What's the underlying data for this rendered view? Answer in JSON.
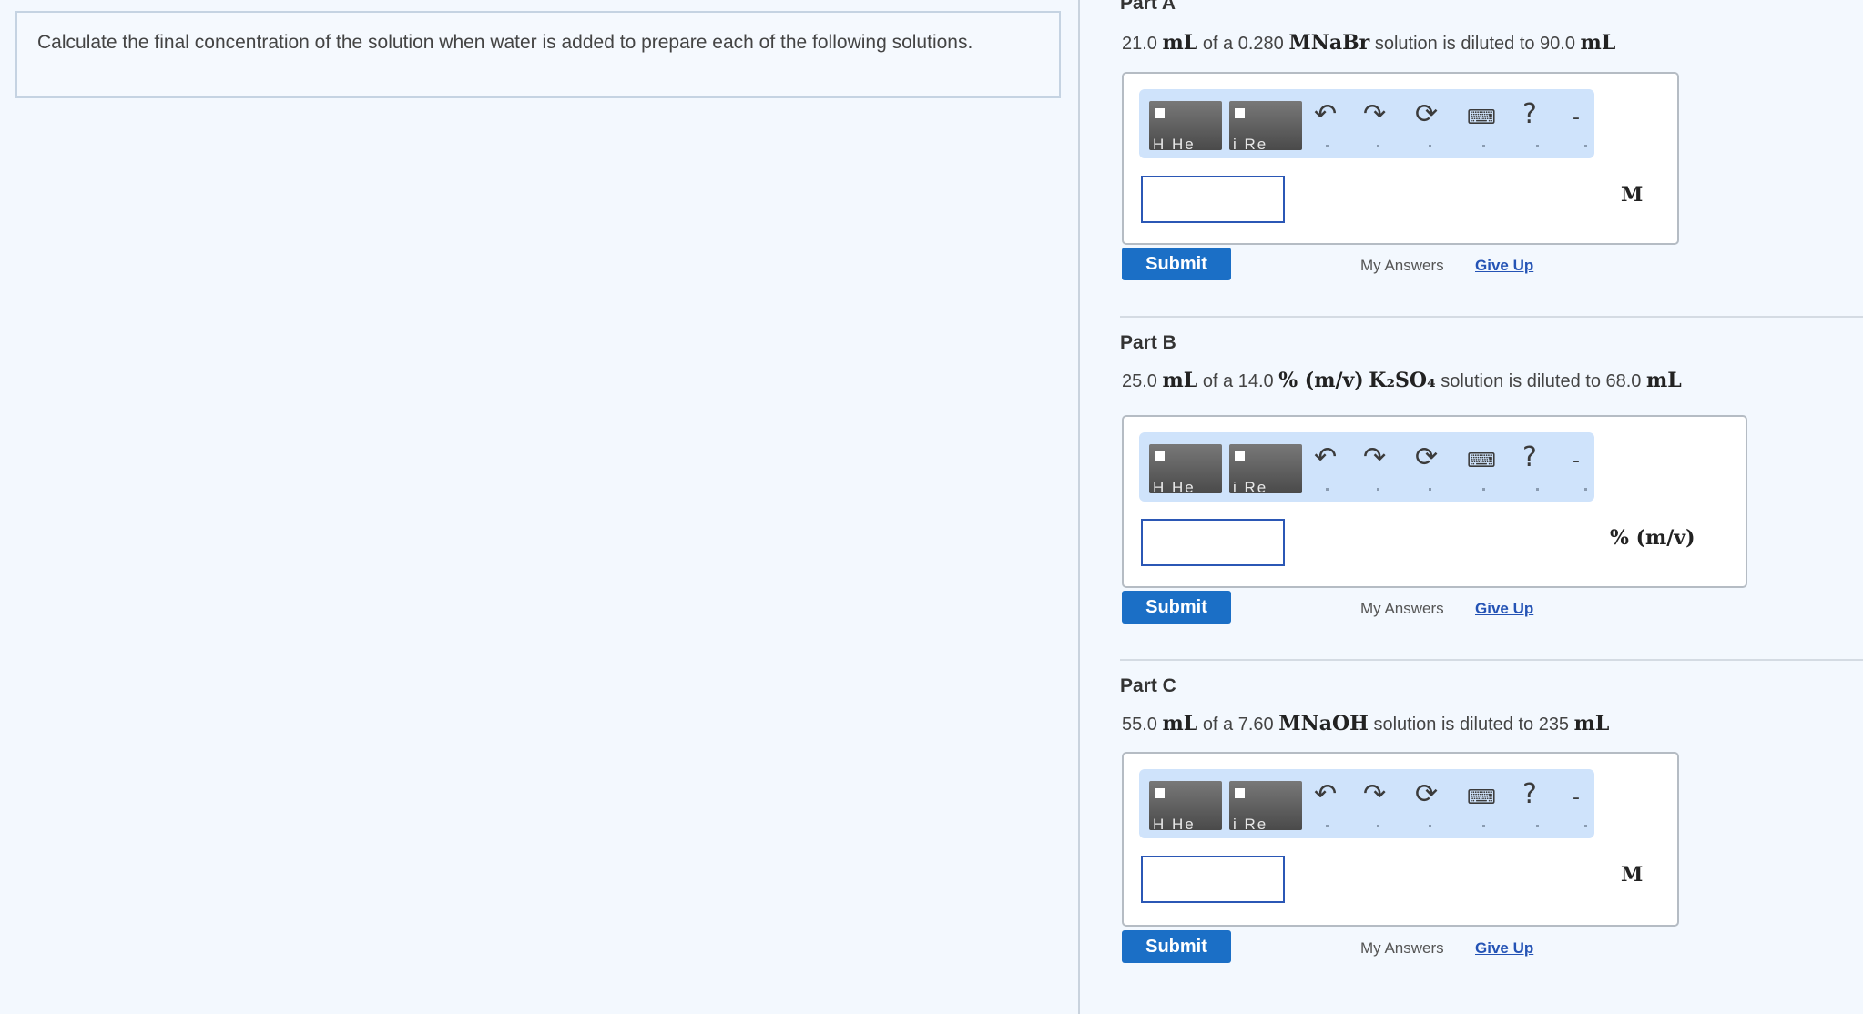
{
  "intro": {
    "text": "Calculate the final concentration of the solution when water is added to prepare each of the following solutions."
  },
  "toolbar": {
    "template1_label": "H He",
    "template2_label": "i Re",
    "undo_icon": "↶",
    "redo_icon": "↷",
    "reset_icon": "⟳",
    "keyboard_icon": "⌨",
    "help_icon": "?"
  },
  "common": {
    "submit_label": "Submit",
    "my_answers_label": "My Answers",
    "give_up_label": "Give Up"
  },
  "parts": [
    {
      "title": "Part A",
      "q_vol1": "21.0",
      "q_unit1": "mL",
      "q_mid": "of a 0.280",
      "q_conc_unit": "M",
      "q_solute": "NaBr",
      "q_end": "solution is diluted to 90.0",
      "q_unit2": "mL",
      "answer_value": "",
      "answer_unit": "M"
    },
    {
      "title": "Part B",
      "q_vol1": "25.0",
      "q_unit1": "mL",
      "q_mid": "of a 14.0",
      "q_conc_unit": "% (m/v)",
      "q_solute": "K₂SO₄",
      "q_end": "solution is diluted to 68.0",
      "q_unit2": "mL",
      "answer_value": "",
      "answer_unit": "% (m/v)"
    },
    {
      "title": "Part C",
      "q_vol1": "55.0",
      "q_unit1": "mL",
      "q_mid": "of a 7.60",
      "q_conc_unit": "M",
      "q_solute": "NaOH",
      "q_end": "solution is diluted to 235",
      "q_unit2": "mL",
      "answer_value": "",
      "answer_unit": "M"
    }
  ]
}
